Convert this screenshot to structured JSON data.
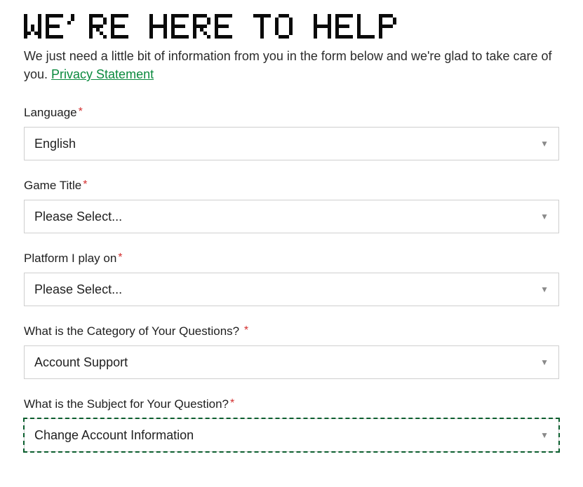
{
  "heading": "WE'RE HERE TO HELP",
  "intro_prefix": "We just need a little bit of information from you in the form below and we're glad to take care of you. ",
  "privacy_link": "Privacy Statement",
  "fields": {
    "language": {
      "label": "Language",
      "value": "English"
    },
    "game_title": {
      "label": "Game Title",
      "value": "Please Select..."
    },
    "platform": {
      "label": "Platform I play on",
      "value": "Please Select..."
    },
    "category": {
      "label": "What is the Category of Your Questions? ",
      "value": "Account Support"
    },
    "subject": {
      "label": "What is the Subject for Your Question?",
      "value": "Change Account Information"
    }
  },
  "required_marker": "*"
}
